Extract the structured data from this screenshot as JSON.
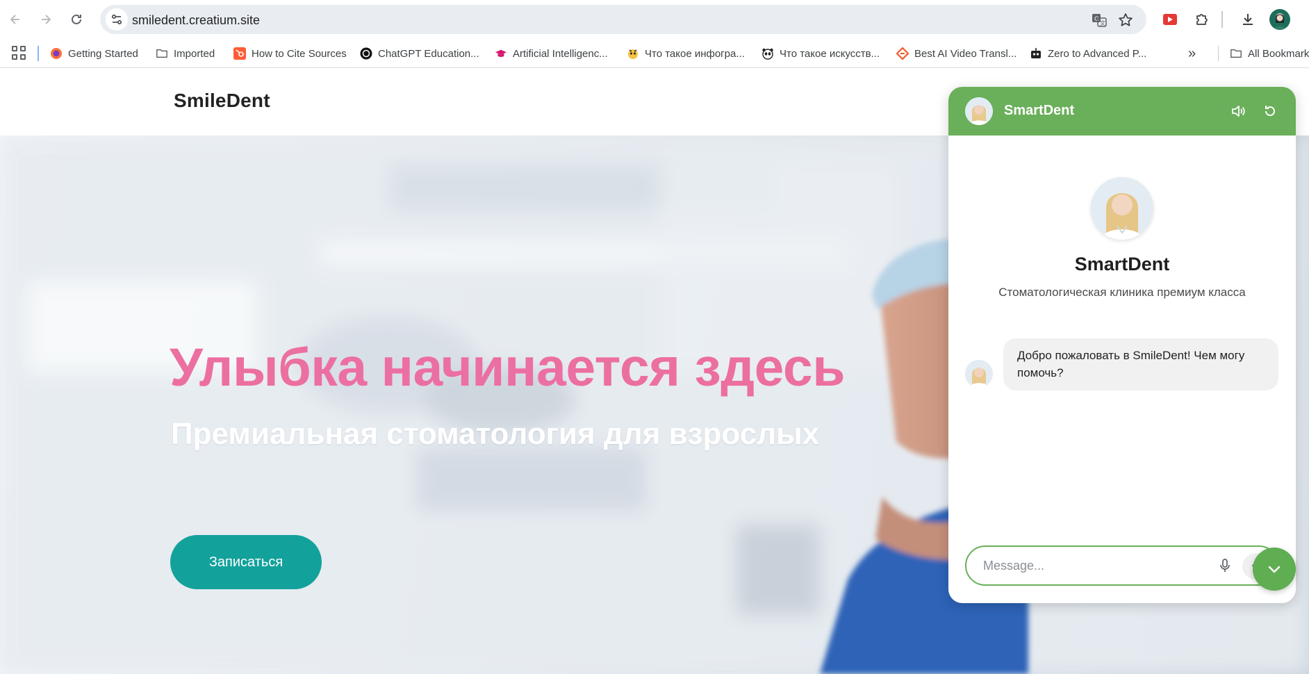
{
  "browser": {
    "url": "smiledent.creatium.site",
    "icons": {
      "back": "arrow-left-icon",
      "forward": "arrow-right-icon",
      "reload": "reload-icon",
      "site_info": "tune-icon",
      "translate": "translate-icon",
      "bookmark": "star-icon",
      "extension": "youtube-extension-icon",
      "extensions": "puzzle-icon",
      "downloads": "download-icon"
    }
  },
  "bookmarks": {
    "items": [
      {
        "label": "Getting Started",
        "icon": "firefox-icon"
      },
      {
        "label": "Imported",
        "icon": "folder-icon"
      },
      {
        "label": "How to Cite Sources",
        "icon": "hubspot-icon"
      },
      {
        "label": "ChatGPT Education...",
        "icon": "openai-icon"
      },
      {
        "label": "Artificial Intelligenc...",
        "icon": "graduation-cap-icon"
      },
      {
        "label": "Что такое инфогра...",
        "icon": "mascot-icon"
      },
      {
        "label": "Что такое искусств...",
        "icon": "panda-icon"
      },
      {
        "label": "Best AI Video Transl...",
        "icon": "diamond-icon"
      },
      {
        "label": "Zero to Advanced P...",
        "icon": "robot-icon"
      }
    ],
    "all_bookmarks": "All Bookmarks"
  },
  "site": {
    "logo": "SmileDent",
    "hero": {
      "title": "Улыбка начинается здесь",
      "subtitle": "Премиальная стоматология для взрослых",
      "cta": "Записаться"
    }
  },
  "chat": {
    "header_title": "SmartDent",
    "bot_name": "SmartDent",
    "bot_description": "Стоматологическая клиника премиум класса",
    "messages": [
      {
        "from": "bot",
        "text": "Добро пожаловать в SmileDent! Чем могу помочь?"
      }
    ],
    "input_placeholder": "Message...",
    "colors": {
      "accent": "#6aaf5a",
      "hero_title": "#ec6fa1",
      "cta": "#13a19b"
    }
  }
}
